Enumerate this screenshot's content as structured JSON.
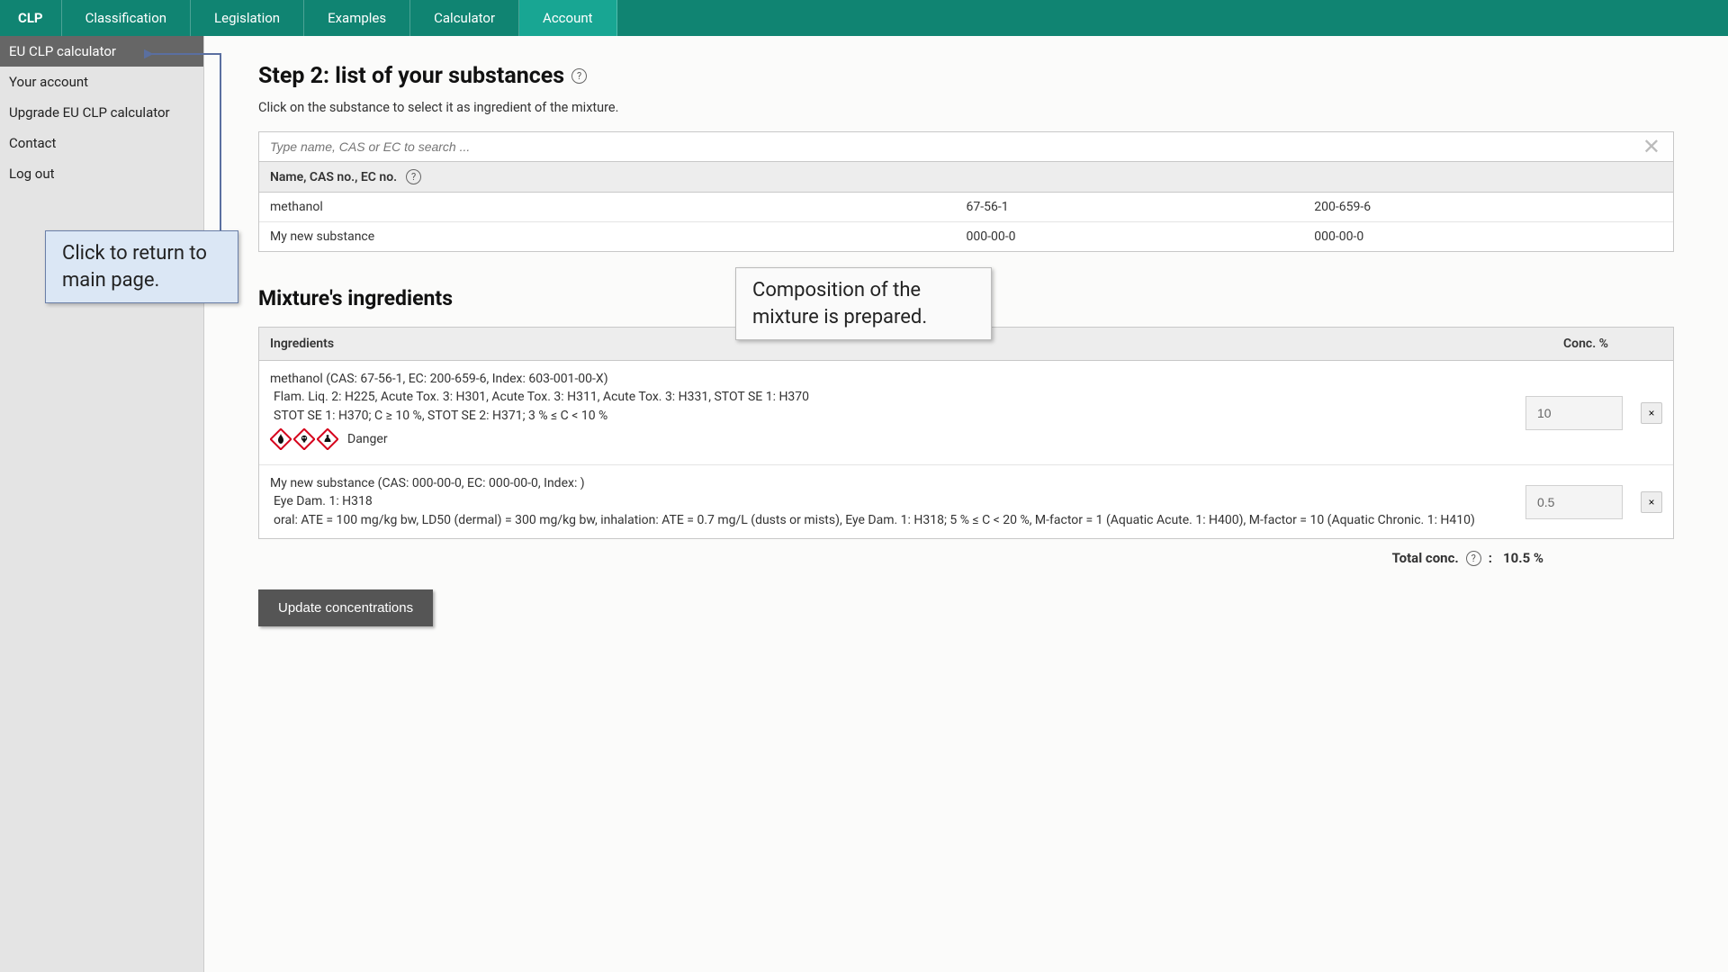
{
  "topnav": {
    "brand": "CLP",
    "items": [
      "Classification",
      "Legislation",
      "Examples",
      "Calculator",
      "Account"
    ],
    "active": "Account"
  },
  "sidebar": {
    "items": [
      "EU CLP calculator",
      "Your account",
      "Upgrade EU CLP calculator",
      "Contact",
      "Log out"
    ],
    "active": "EU CLP calculator"
  },
  "callouts": {
    "return": "Click to return to main page.",
    "composition": "Composition of the mixture is prepared."
  },
  "main": {
    "step_title": "Step 2:  list of your substances",
    "subtitle": "Click on the substance to select it as ingredient of the mixture.",
    "search": {
      "placeholder": "Type name, CAS or EC to search ..."
    },
    "substances": {
      "header": "Name, CAS no., EC no.",
      "rows": [
        {
          "name": "methanol",
          "cas": "67-56-1",
          "ec": "200-659-6"
        },
        {
          "name": "My new substance",
          "cas": "000-00-0",
          "ec": "000-00-0"
        }
      ]
    },
    "ingredients": {
      "title": "Mixture's ingredients",
      "header_ing": "Ingredients",
      "header_conc": "Conc. %",
      "rows": [
        {
          "line1": "methanol (CAS: 67-56-1, EC: 200-659-6, Index: 603-001-00-X)",
          "line2": "Flam. Liq. 2: H225,  Acute Tox. 3: H301,  Acute Tox. 3: H311,  Acute Tox. 3: H331,  STOT SE 1: H370",
          "line3": "STOT SE 1: H370; C ≥ 10 %,  STOT SE 2: H371; 3 % ≤ C < 10 %",
          "signal": "Danger",
          "conc": "10"
        },
        {
          "line1": "My new substance (CAS: 000-00-0, EC: 000-00-0, Index: )",
          "line2": "Eye Dam. 1: H318",
          "line3": "oral: ATE = 100 mg/kg bw,  LD50 (dermal) = 300 mg/kg bw,  inhalation: ATE = 0.7 mg/L (dusts or mists),  Eye Dam. 1: H318; 5 % ≤ C < 20 %,  M-factor = 1 (Aquatic Acute. 1: H400),  M-factor = 10 (Aquatic Chronic. 1: H410)",
          "conc": "0.5"
        }
      ]
    },
    "total": {
      "label": "Total conc.",
      "value": "10.5 %"
    },
    "update_button": "Update concentrations"
  }
}
